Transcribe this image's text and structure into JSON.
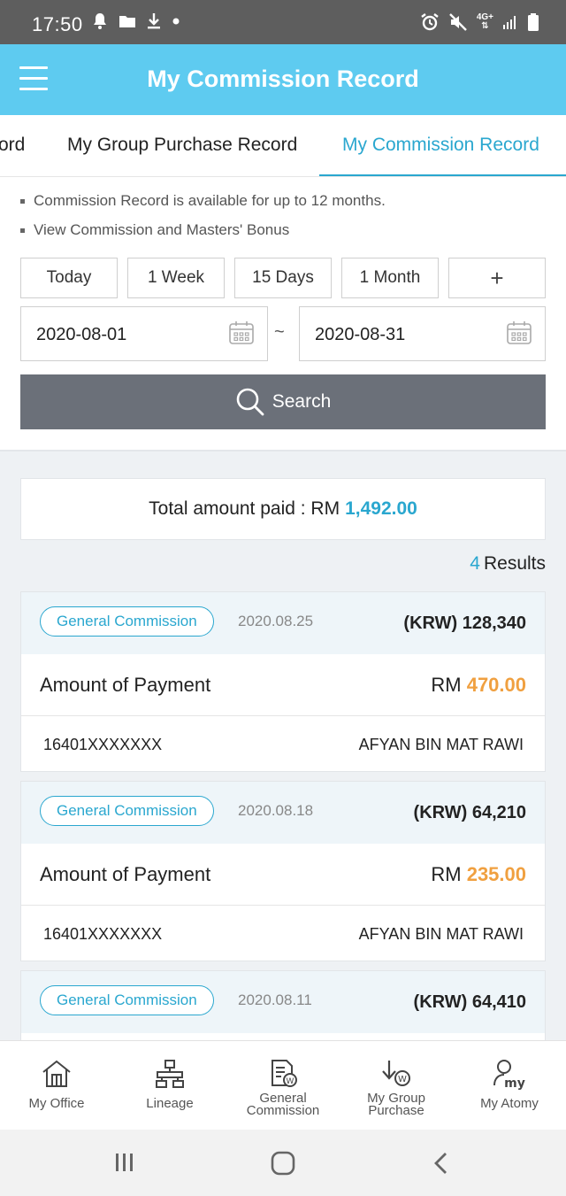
{
  "status_bar": {
    "time": "17:50",
    "left_icons": [
      "bell-icon",
      "folder-icon",
      "download-icon",
      "dot-icon"
    ],
    "right_icons": [
      "alarm-icon",
      "mute-icon",
      "network-4g-icon",
      "signal-icon",
      "battery-icon"
    ],
    "network_label": "4G+"
  },
  "app_bar": {
    "title": "My Commission Record"
  },
  "tabs": [
    {
      "label": "ord",
      "active": false
    },
    {
      "label": "My Group Purchase Record",
      "active": false
    },
    {
      "label": "My Commission Record",
      "active": true
    }
  ],
  "notes": [
    "Commission Record is available for up to 12 months.",
    "View Commission and Masters' Bonus"
  ],
  "period_buttons": [
    "Today",
    "1 Week",
    "15 Days",
    "1 Month",
    "+"
  ],
  "date_range": {
    "from": "2020-08-01",
    "separator": "~",
    "to": "2020-08-31"
  },
  "search": {
    "label": "Search"
  },
  "summary": {
    "total_label": "Total amount paid : RM",
    "total_value": "1,492.00"
  },
  "results": {
    "count": "4",
    "label": "Results"
  },
  "records": [
    {
      "type": "General Commission",
      "date": "2020.08.25",
      "krw": "(KRW) 128,340",
      "payment_label": "Amount of Payment",
      "currency": "RM",
      "amount": "470.00",
      "member_id": "16401XXXXXXX",
      "member_name": "AFYAN BIN MAT RAWI"
    },
    {
      "type": "General Commission",
      "date": "2020.08.18",
      "krw": "(KRW) 64,210",
      "payment_label": "Amount of Payment",
      "currency": "RM",
      "amount": "235.00",
      "member_id": "16401XXXXXXX",
      "member_name": "AFYAN BIN MAT RAWI"
    },
    {
      "type": "General Commission",
      "date": "2020.08.11",
      "krw": "(KRW) 64,410"
    }
  ],
  "bottom_nav": [
    {
      "label": "My Office",
      "icon": "home-icon"
    },
    {
      "label": "Lineage",
      "icon": "org-chart-icon"
    },
    {
      "label": "General Commission",
      "icon": "document-won-icon"
    },
    {
      "label": "My Group Purchase",
      "icon": "download-won-icon"
    },
    {
      "label": "My Atomy",
      "icon": "user-my-icon",
      "icon_text": "my"
    }
  ],
  "colors": {
    "accent": "#2aa7cf",
    "header": "#5ecbf0",
    "amount": "#f0a040",
    "search_button": "#6b7079"
  }
}
